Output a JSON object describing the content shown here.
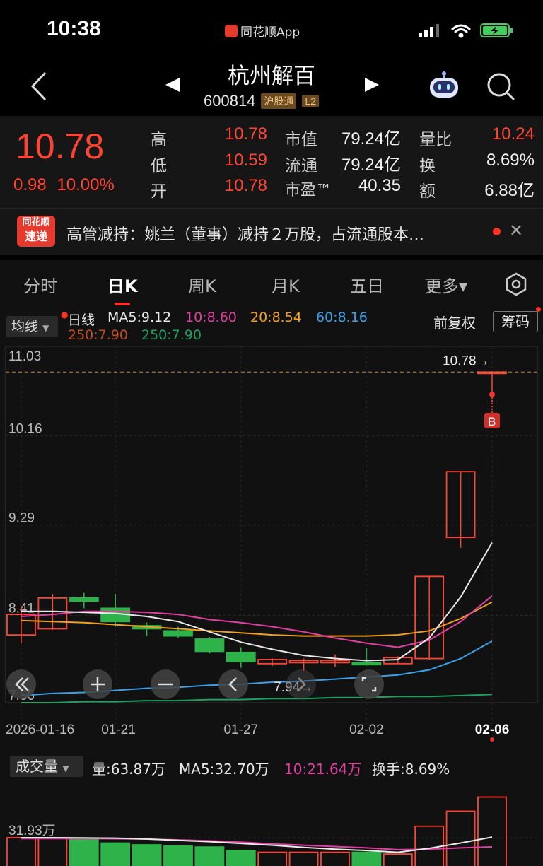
{
  "status": {
    "time": "10:38",
    "app_name": "同花顺App"
  },
  "header": {
    "stock_name": "杭州解百",
    "stock_code": "600814",
    "tag_market": "沪股通",
    "tag_level": "L2"
  },
  "quote": {
    "price": "10.78",
    "change": "0.98",
    "change_pct": "10.00%",
    "high_label": "高",
    "high": "10.78",
    "low_label": "低",
    "low": "10.59",
    "open_label": "开",
    "open": "10.78",
    "mktcap_label": "市值",
    "mktcap": "79.24亿",
    "float_label": "流通",
    "float": "79.24亿",
    "pe_label": "市盈™",
    "pe": "40.35",
    "vr_label": "量比",
    "vr": "10.24",
    "turn_label": "换",
    "turn": "8.69%",
    "amt_label": "额",
    "amt": "6.88亿"
  },
  "news": {
    "logo_top": "同花顺",
    "logo_bottom": "速递",
    "text": "高管减持：姚兰（董事）减持２万股，占流通股本…",
    "close": "✕"
  },
  "tabs": [
    {
      "label": "分时"
    },
    {
      "label": "日K"
    },
    {
      "label": "周K"
    },
    {
      "label": "月K"
    },
    {
      "label": "五日"
    },
    {
      "label": "更多▾"
    }
  ],
  "chart_toolbar": {
    "ma_select": "均线",
    "period": "日线",
    "ma5": "MA5:9.12",
    "ma10": "10:8.60",
    "ma20": "20:8.54",
    "ma60": "60:8.16",
    "ma250a": "250:7.90",
    "ma250b": "250:7.90",
    "adjust": "前复权",
    "chips": "筹码"
  },
  "volume_toolbar": {
    "select": "成交量",
    "vol": "量:63.87万",
    "ma5": "MA5:32.70万",
    "ma10": "10:21.64万",
    "turnover": "换手:8.69%"
  },
  "colors": {
    "up": "#ff4433",
    "down": "#2db34a",
    "ma5": "#e8e8e8",
    "ma10": "#e040a0",
    "ma20": "#f0a020",
    "ma60": "#3aa0e8",
    "ma250": "#20a060",
    "ma250a": "#c05020"
  },
  "chart_data": {
    "type": "candlestick",
    "y_ticks": [
      "11.03",
      "10.16",
      "9.29",
      "8.41",
      "7.56"
    ],
    "x_ticks": [
      "2026-01-16",
      "01-21",
      "01-27",
      "02-02",
      "02-06"
    ],
    "last_price_label": "10.78→",
    "min_label": "7.94→",
    "buy_marker": "B",
    "candles": [
      {
        "o": 8.22,
        "c": 8.42,
        "h": 8.5,
        "l": 8.14
      },
      {
        "o": 8.28,
        "c": 8.58,
        "h": 8.62,
        "l": 8.27
      },
      {
        "o": 8.58,
        "c": 8.55,
        "h": 8.63,
        "l": 8.48
      },
      {
        "o": 8.48,
        "c": 8.35,
        "h": 8.62,
        "l": 8.3
      },
      {
        "o": 8.31,
        "c": 8.28,
        "h": 8.34,
        "l": 8.21
      },
      {
        "o": 8.26,
        "c": 8.21,
        "h": 8.3,
        "l": 8.19
      },
      {
        "o": 8.18,
        "c": 8.06,
        "h": 8.2,
        "l": 8.04
      },
      {
        "o": 8.05,
        "c": 7.96,
        "h": 8.1,
        "l": 7.9
      },
      {
        "o": 7.94,
        "c": 7.98,
        "h": 7.99,
        "l": 7.92
      },
      {
        "o": 7.95,
        "c": 7.97,
        "h": 7.99,
        "l": 7.87
      },
      {
        "o": 7.95,
        "c": 7.97,
        "h": 8.03,
        "l": 7.91
      },
      {
        "o": 7.95,
        "c": 7.93,
        "h": 8.09,
        "l": 7.92
      },
      {
        "o": 7.94,
        "c": 8.0,
        "h": 8.01,
        "l": 7.94
      },
      {
        "o": 7.99,
        "c": 8.79,
        "h": 8.79,
        "l": 7.98
      },
      {
        "o": 9.17,
        "c": 9.81,
        "h": 9.81,
        "l": 9.07
      },
      {
        "o": 10.78,
        "c": 10.78,
        "h": 10.78,
        "l": 10.59
      }
    ],
    "ma5": [
      8.45,
      8.45,
      8.44,
      8.43,
      8.4,
      8.35,
      8.25,
      8.15,
      8.08,
      8.02,
      7.99,
      7.97,
      7.98,
      8.19,
      8.59,
      9.12
    ],
    "ma10": [
      8.4,
      8.42,
      8.45,
      8.45,
      8.44,
      8.42,
      8.37,
      8.34,
      8.3,
      8.25,
      8.19,
      8.14,
      8.1,
      8.17,
      8.35,
      8.6
    ],
    "ma20": [
      8.36,
      8.35,
      8.34,
      8.32,
      8.3,
      8.28,
      8.26,
      8.24,
      8.22,
      8.21,
      8.21,
      8.21,
      8.22,
      8.26,
      8.38,
      8.54
    ],
    "ma60": [
      7.63,
      7.65,
      7.66,
      7.68,
      7.7,
      7.71,
      7.73,
      7.74,
      7.76,
      7.77,
      7.79,
      7.81,
      7.83,
      7.88,
      7.99,
      8.16
    ],
    "ma250": [
      7.56,
      7.56,
      7.57,
      7.57,
      7.58,
      7.58,
      7.59,
      7.59,
      7.6,
      7.6,
      7.61,
      7.61,
      7.62,
      7.62,
      7.63,
      7.64
    ],
    "volume_tick": "31.93万",
    "volumes": [
      32.0,
      32.0,
      30.0,
      26.0,
      24.0,
      22.5,
      21.5,
      17.5,
      15.5,
      15.5,
      15.5,
      15.5,
      13.5,
      45.0,
      62.0,
      78.0
    ],
    "vol_ma5": [
      32.0,
      32.0,
      31.8,
      31.5,
      30.5,
      29.0,
      27.5,
      25.5,
      23.5,
      21.0,
      19.0,
      17.5,
      15.5,
      20.0,
      26.0,
      32.7
    ],
    "vol_ma10": [
      31.0,
      31.0,
      31.0,
      30.8,
      30.4,
      29.5,
      28.5,
      27.0,
      25.0,
      23.5,
      22.0,
      20.5,
      18.5,
      19.0,
      20.5,
      21.64
    ]
  }
}
